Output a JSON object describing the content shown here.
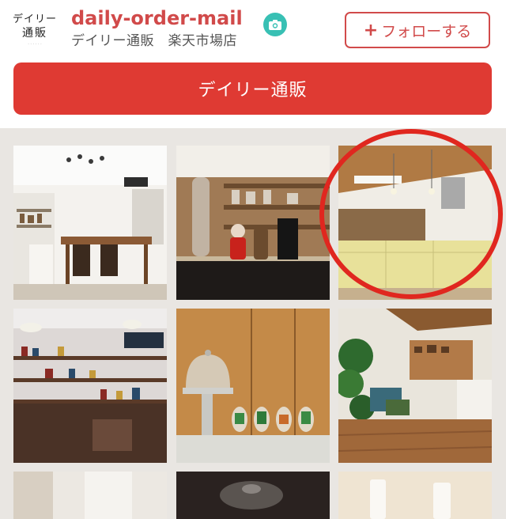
{
  "profile": {
    "logo_line1": "デイリー",
    "logo_line2": "通販",
    "shop_name": "daily-order-mail",
    "subtitle": "デイリー通販　楽天市場店",
    "camera_icon": "camera-icon",
    "follow_label": "フォローする",
    "follow_icon": "plus-icon"
  },
  "cta": {
    "label": "デイリー通販"
  },
  "colors": {
    "brand_red": "#df3a33",
    "accent_teal": "#38c0b4",
    "highlight_ring": "#e0271f"
  },
  "grid": {
    "tiles": [
      {
        "name": "photo-white-kitchen-dining"
      },
      {
        "name": "photo-christmas-shelf"
      },
      {
        "name": "photo-wood-ceiling-kitchen"
      },
      {
        "name": "photo-cafe-shelf-wall"
      },
      {
        "name": "photo-cake-dome-cactus"
      },
      {
        "name": "photo-green-living-room"
      },
      {
        "name": "photo-bottom-1"
      },
      {
        "name": "photo-bottom-2"
      },
      {
        "name": "photo-bottom-3"
      },
      {
        "name": "photo-bottom-4"
      }
    ]
  }
}
